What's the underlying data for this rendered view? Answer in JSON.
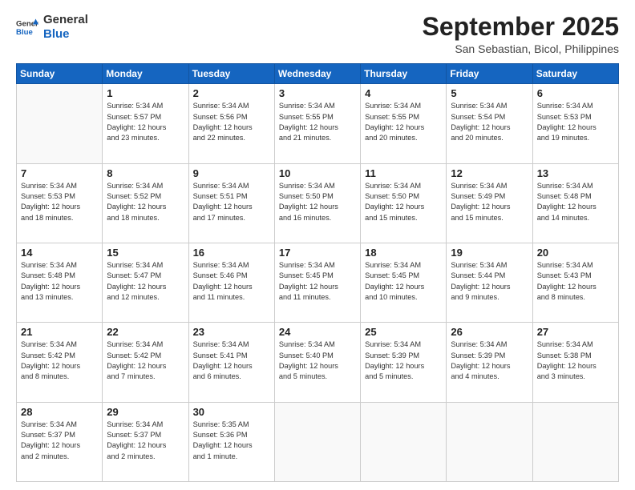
{
  "header": {
    "logo_general": "General",
    "logo_blue": "Blue",
    "month_year": "September 2025",
    "location": "San Sebastian, Bicol, Philippines"
  },
  "days_of_week": [
    "Sunday",
    "Monday",
    "Tuesday",
    "Wednesday",
    "Thursday",
    "Friday",
    "Saturday"
  ],
  "weeks": [
    [
      {
        "day": "",
        "info": ""
      },
      {
        "day": "1",
        "info": "Sunrise: 5:34 AM\nSunset: 5:57 PM\nDaylight: 12 hours\nand 23 minutes."
      },
      {
        "day": "2",
        "info": "Sunrise: 5:34 AM\nSunset: 5:56 PM\nDaylight: 12 hours\nand 22 minutes."
      },
      {
        "day": "3",
        "info": "Sunrise: 5:34 AM\nSunset: 5:55 PM\nDaylight: 12 hours\nand 21 minutes."
      },
      {
        "day": "4",
        "info": "Sunrise: 5:34 AM\nSunset: 5:55 PM\nDaylight: 12 hours\nand 20 minutes."
      },
      {
        "day": "5",
        "info": "Sunrise: 5:34 AM\nSunset: 5:54 PM\nDaylight: 12 hours\nand 20 minutes."
      },
      {
        "day": "6",
        "info": "Sunrise: 5:34 AM\nSunset: 5:53 PM\nDaylight: 12 hours\nand 19 minutes."
      }
    ],
    [
      {
        "day": "7",
        "info": "Sunrise: 5:34 AM\nSunset: 5:53 PM\nDaylight: 12 hours\nand 18 minutes."
      },
      {
        "day": "8",
        "info": "Sunrise: 5:34 AM\nSunset: 5:52 PM\nDaylight: 12 hours\nand 18 minutes."
      },
      {
        "day": "9",
        "info": "Sunrise: 5:34 AM\nSunset: 5:51 PM\nDaylight: 12 hours\nand 17 minutes."
      },
      {
        "day": "10",
        "info": "Sunrise: 5:34 AM\nSunset: 5:50 PM\nDaylight: 12 hours\nand 16 minutes."
      },
      {
        "day": "11",
        "info": "Sunrise: 5:34 AM\nSunset: 5:50 PM\nDaylight: 12 hours\nand 15 minutes."
      },
      {
        "day": "12",
        "info": "Sunrise: 5:34 AM\nSunset: 5:49 PM\nDaylight: 12 hours\nand 15 minutes."
      },
      {
        "day": "13",
        "info": "Sunrise: 5:34 AM\nSunset: 5:48 PM\nDaylight: 12 hours\nand 14 minutes."
      }
    ],
    [
      {
        "day": "14",
        "info": "Sunrise: 5:34 AM\nSunset: 5:48 PM\nDaylight: 12 hours\nand 13 minutes."
      },
      {
        "day": "15",
        "info": "Sunrise: 5:34 AM\nSunset: 5:47 PM\nDaylight: 12 hours\nand 12 minutes."
      },
      {
        "day": "16",
        "info": "Sunrise: 5:34 AM\nSunset: 5:46 PM\nDaylight: 12 hours\nand 11 minutes."
      },
      {
        "day": "17",
        "info": "Sunrise: 5:34 AM\nSunset: 5:45 PM\nDaylight: 12 hours\nand 11 minutes."
      },
      {
        "day": "18",
        "info": "Sunrise: 5:34 AM\nSunset: 5:45 PM\nDaylight: 12 hours\nand 10 minutes."
      },
      {
        "day": "19",
        "info": "Sunrise: 5:34 AM\nSunset: 5:44 PM\nDaylight: 12 hours\nand 9 minutes."
      },
      {
        "day": "20",
        "info": "Sunrise: 5:34 AM\nSunset: 5:43 PM\nDaylight: 12 hours\nand 8 minutes."
      }
    ],
    [
      {
        "day": "21",
        "info": "Sunrise: 5:34 AM\nSunset: 5:42 PM\nDaylight: 12 hours\nand 8 minutes."
      },
      {
        "day": "22",
        "info": "Sunrise: 5:34 AM\nSunset: 5:42 PM\nDaylight: 12 hours\nand 7 minutes."
      },
      {
        "day": "23",
        "info": "Sunrise: 5:34 AM\nSunset: 5:41 PM\nDaylight: 12 hours\nand 6 minutes."
      },
      {
        "day": "24",
        "info": "Sunrise: 5:34 AM\nSunset: 5:40 PM\nDaylight: 12 hours\nand 5 minutes."
      },
      {
        "day": "25",
        "info": "Sunrise: 5:34 AM\nSunset: 5:39 PM\nDaylight: 12 hours\nand 5 minutes."
      },
      {
        "day": "26",
        "info": "Sunrise: 5:34 AM\nSunset: 5:39 PM\nDaylight: 12 hours\nand 4 minutes."
      },
      {
        "day": "27",
        "info": "Sunrise: 5:34 AM\nSunset: 5:38 PM\nDaylight: 12 hours\nand 3 minutes."
      }
    ],
    [
      {
        "day": "28",
        "info": "Sunrise: 5:34 AM\nSunset: 5:37 PM\nDaylight: 12 hours\nand 2 minutes."
      },
      {
        "day": "29",
        "info": "Sunrise: 5:34 AM\nSunset: 5:37 PM\nDaylight: 12 hours\nand 2 minutes."
      },
      {
        "day": "30",
        "info": "Sunrise: 5:35 AM\nSunset: 5:36 PM\nDaylight: 12 hours\nand 1 minute."
      },
      {
        "day": "",
        "info": ""
      },
      {
        "day": "",
        "info": ""
      },
      {
        "day": "",
        "info": ""
      },
      {
        "day": "",
        "info": ""
      }
    ]
  ]
}
